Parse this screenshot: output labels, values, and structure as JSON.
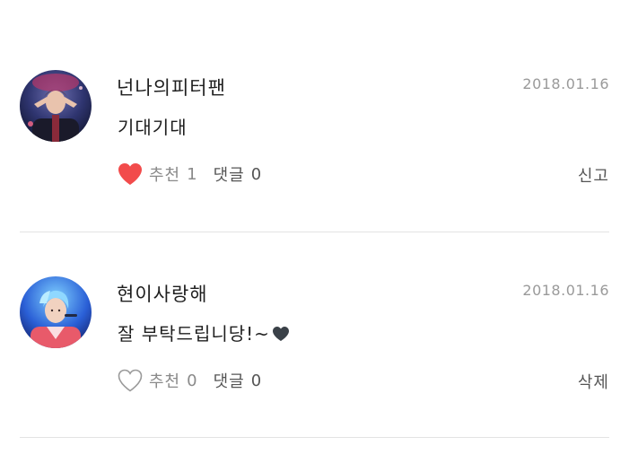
{
  "comments": [
    {
      "author": "넌나의피터팬",
      "date": "2018.01.16",
      "text": "기대기대",
      "liked": true,
      "like_label": "추천",
      "like_count": "1",
      "reply_label": "댓글",
      "reply_count": "0",
      "side_action": "신고",
      "heart_color": "#f24b4b",
      "avatar_icon": "avatar-stage-photo"
    },
    {
      "author": "현이사랑해",
      "date": "2018.01.16",
      "text": "잘 부탁드립니당!~",
      "text_suffix_icon": "dark-heart-icon",
      "liked": false,
      "like_label": "추천",
      "like_count": "0",
      "reply_label": "댓글",
      "reply_count": "0",
      "side_action": "삭제",
      "heart_color": "#9a9a9a",
      "avatar_icon": "avatar-stage-photo"
    }
  ]
}
